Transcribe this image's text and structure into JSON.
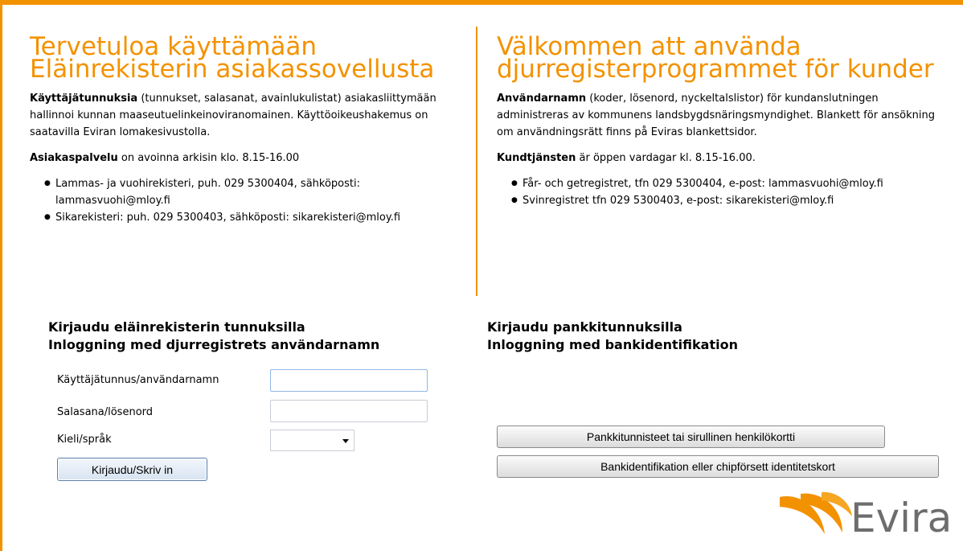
{
  "colors": {
    "accent": "#f39200",
    "logo_text": "#6d6d6d"
  },
  "finnish": {
    "title": "Tervetuloa käyttämään Eläinrekisterin asiakassovellusta",
    "intro_bold": "Käyttäjätunnuksia",
    "intro_text": " (tunnukset, salasanat, avainlukulistat) asiakasliittymään hallinnoi kunnan maaseutuelinkeinoviranomainen. Käyttöoikeushakemus on saatavilla Eviran lomakesivustolla.",
    "service_bold": "Asiakaspalvelu",
    "service_text": " on avoinna arkisin klo. 8.15-16.00",
    "contacts": [
      "Lammas- ja vuohirekisteri, puh. 029 5300404, sähköposti: lammasvuohi@mloy.fi",
      "Sikarekisteri: puh. 029 5300403, sähköposti: sikarekisteri@mloy.fi"
    ]
  },
  "swedish": {
    "title": "Välkommen att använda djurregisterprogrammet för kunder",
    "intro_bold": "Användarnamn",
    "intro_text": " (koder, lösenord, nyckeltalslistor) för kundanslutningen administreras av kommunens landsbygdsnäringsmyndighet. Blankett för ansökning om användningsrätt finns på Eviras blankettsidor.",
    "service_bold": "Kundtjänsten",
    "service_text": " är öppen vardagar kl. 8.15-16.00.",
    "contacts": [
      "Får- och getregistret, tfn 029 5300404, e-post: lammasvuohi@mloy.fi",
      "Svinregistret tfn 029 5300403, e-post: sikarekisteri@mloy.fi"
    ]
  },
  "login_form": {
    "heading_line1": "Kirjaudu eläinrekisterin tunnuksilla",
    "heading_line2": "Inloggning med djurregistrets användarnamn",
    "username_label": "Käyttäjätunnus/användarnamn",
    "username_value": "",
    "password_label": "Salasana/lösenord",
    "password_value": "",
    "language_label": "Kieli/språk",
    "language_value": "",
    "submit_label": "Kirjaudu/Skriv in"
  },
  "bank_login": {
    "heading_line1": "Kirjaudu pankkitunnuksilla",
    "heading_line2": "Inloggning med bankidentifikation",
    "button_fi": "Pankkitunnisteet tai sirullinen henkilökortti",
    "button_sv": "Bankidentifikation eller chipförsett identitetskort"
  },
  "logo": {
    "text": "Evira"
  }
}
